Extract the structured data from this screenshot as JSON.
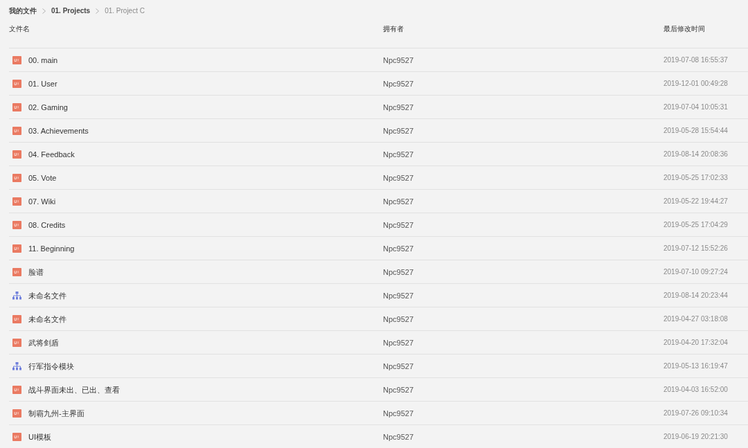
{
  "breadcrumb": [
    {
      "label": "我的文件",
      "current": false
    },
    {
      "label": "01. Projects",
      "current": false
    },
    {
      "label": "01. Project C",
      "current": true
    }
  ],
  "table": {
    "columns": [
      "文件名",
      "拥有者",
      "最后修改时间"
    ],
    "rows": [
      {
        "kind": "ui",
        "name": "00. main",
        "owner": "Npc9527",
        "modified": "2019-07-08 16:55:37"
      },
      {
        "kind": "ui",
        "name": "01. User",
        "owner": "Npc9527",
        "modified": "2019-12-01 00:49:28"
      },
      {
        "kind": "ui",
        "name": "02. Gaming",
        "owner": "Npc9527",
        "modified": "2019-07-04 10:05:31"
      },
      {
        "kind": "ui",
        "name": "03. Achievements",
        "owner": "Npc9527",
        "modified": "2019-05-28 15:54:44"
      },
      {
        "kind": "ui",
        "name": "04. Feedback",
        "owner": "Npc9527",
        "modified": "2019-08-14 20:08:36"
      },
      {
        "kind": "ui",
        "name": "05. Vote",
        "owner": "Npc9527",
        "modified": "2019-05-25 17:02:33"
      },
      {
        "kind": "ui",
        "name": "07. Wiki",
        "owner": "Npc9527",
        "modified": "2019-05-22 19:44:27"
      },
      {
        "kind": "ui",
        "name": "08. Credits",
        "owner": "Npc9527",
        "modified": "2019-05-25 17:04:29"
      },
      {
        "kind": "ui",
        "name": "11. Beginning",
        "owner": "Npc9527",
        "modified": "2019-07-12 15:52:26"
      },
      {
        "kind": "ui",
        "name": "脸谱",
        "owner": "Npc9527",
        "modified": "2019-07-10 09:27:24"
      },
      {
        "kind": "flow",
        "name": "未命名文件",
        "owner": "Npc9527",
        "modified": "2019-08-14 20:23:44"
      },
      {
        "kind": "ui",
        "name": "未命名文件",
        "owner": "Npc9527",
        "modified": "2019-04-27 03:18:08"
      },
      {
        "kind": "ui",
        "name": "武将剑盾",
        "owner": "Npc9527",
        "modified": "2019-04-20 17:32:04"
      },
      {
        "kind": "flow",
        "name": "行军指令模块",
        "owner": "Npc9527",
        "modified": "2019-05-13 16:19:47"
      },
      {
        "kind": "ui",
        "name": "战斗界面未出、已出、查看",
        "owner": "Npc9527",
        "modified": "2019-04-03 16:52:00"
      },
      {
        "kind": "ui",
        "name": "制霸九州-主界面",
        "owner": "Npc9527",
        "modified": "2019-07-26 09:10:34"
      },
      {
        "kind": "ui",
        "name": "UI模板",
        "owner": "Npc9527",
        "modified": "2019-06-19 20:21:30"
      }
    ]
  }
}
